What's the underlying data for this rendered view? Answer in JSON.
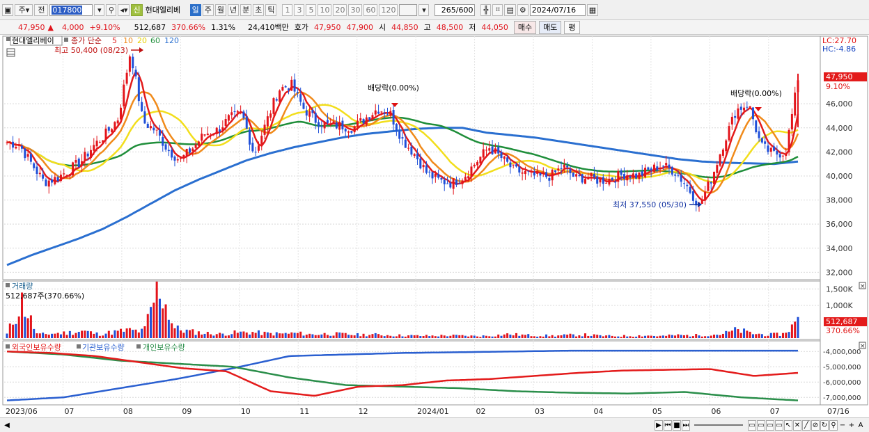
{
  "toolbar": {
    "market_label": "주",
    "prev_label": "전",
    "stock_code": "017800",
    "badge_label": "신",
    "stock_name": "현대엘리베",
    "period_buttons": [
      "일",
      "주",
      "월",
      "년",
      "분",
      "초",
      "틱"
    ],
    "selected_period": "일",
    "interval_buttons": [
      "1",
      "3",
      "5",
      "10",
      "20",
      "30",
      "60",
      "120"
    ],
    "bar_count": "265",
    "bar_total": "/600",
    "date": "2024/07/16"
  },
  "quote": {
    "price": "47,950",
    "change_arrow": "▲",
    "change": "4,000",
    "change_pct": "+9.10%",
    "volume": "512,687",
    "volume_ratio": "370.66%",
    "turnover": "1.31%",
    "amount": "24,410백만",
    "hoga_label": "호가",
    "hoga_sell": "47,950",
    "hoga_buy": "47,900",
    "open_label": "시",
    "open": "44,850",
    "high_label": "고",
    "high": "48,500",
    "low_label": "저",
    "low": "44,050",
    "buy_button": "매수",
    "sell_button": "매도",
    "eval_button": "평"
  },
  "price_panel": {
    "stock_name_box": "현대엘리베이",
    "ma_title": "종가 단순",
    "ma_periods": [
      {
        "label": "5",
        "color": "#e31b1b"
      },
      {
        "label": "10",
        "color": "#f08a1a"
      },
      {
        "label": "20",
        "color": "#e8d200"
      },
      {
        "label": "60",
        "color": "#1f8e3a"
      },
      {
        "label": "120",
        "color": "#2a6fd0"
      }
    ],
    "lc_label": "LC:27.70",
    "hc_label": "HC:-4.86",
    "price_tag": "47,950",
    "pct_tag": "9.10%",
    "high_annotation": "최고 50,400 (08/23)",
    "low_annotation": "최저 37,550 (05/30)",
    "dividend_annotation_1": "배당락(0.00%)",
    "dividend_annotation_2": "배당락(0.00%)"
  },
  "volume_panel": {
    "title": "거래량",
    "value_label": "512,687주(370.66%)",
    "tag_value": "512,687",
    "tag_pct": "370.66%"
  },
  "holding_panel": {
    "legend": [
      {
        "label": "외국인보유수량",
        "color": "#e31b1b"
      },
      {
        "label": "기관보유수량",
        "color": "#2a5fd0"
      },
      {
        "label": "개인보유수량",
        "color": "#2a8e4a"
      }
    ]
  },
  "chart_data": {
    "type": "line",
    "x_axis_labels": [
      "2023/06",
      "07",
      "08",
      "09",
      "10",
      "11",
      "12",
      "2024/01",
      "02",
      "03",
      "04",
      "05",
      "06",
      "07",
      "07/16"
    ],
    "price_axis_ticks": [
      "32,000",
      "34,000",
      "36,000",
      "38,000",
      "40,000",
      "42,000",
      "44,000",
      "46,000"
    ],
    "price_ylim": [
      31500,
      51500
    ],
    "volume_axis_ticks": [
      "1,500K",
      "1,000K",
      "500K"
    ],
    "volume_ylim": [
      0,
      1700
    ],
    "holding_axis_ticks": [
      "-4,000,000",
      "-5,000,000",
      "-6,000,000",
      "-7,000,000"
    ],
    "holding_ylim": [
      -7400000,
      -3400000
    ],
    "price_close_approx": [
      42800,
      42600,
      41000,
      39500,
      39800,
      40500,
      41200,
      42500,
      43500,
      44800,
      50400,
      44500,
      43800,
      42200,
      41300,
      42300,
      43500,
      43800,
      44800,
      45200,
      41800,
      44500,
      47200,
      47600,
      45600,
      44600,
      44200,
      44200,
      44000,
      44800,
      45600,
      45200,
      43000,
      41800,
      40200,
      39600,
      39400,
      40000,
      41200,
      42400,
      41500,
      40500,
      40200,
      39900,
      40000,
      40800,
      39800,
      39900,
      39600,
      39800,
      40200,
      40000,
      40500,
      40900,
      40400,
      39200,
      37550,
      39800,
      42800,
      45500,
      46000,
      42500,
      41800,
      42000,
      47950
    ],
    "ma120_approx": [
      32600,
      33400,
      34100,
      34800,
      35600,
      36600,
      37700,
      38800,
      39700,
      40500,
      41300,
      41900,
      42400,
      42800,
      43200,
      43500,
      43700,
      43900,
      44000,
      44000,
      43600,
      43400,
      43200,
      42900,
      42600,
      42300,
      42000,
      41700,
      41400,
      41200,
      41100,
      41050,
      41000,
      41200
    ],
    "volume_k_approx": [
      120,
      1120,
      100,
      140,
      160,
      220,
      120,
      180,
      240,
      200,
      1600,
      300,
      200,
      150,
      120,
      160,
      180,
      140,
      130,
      150,
      110,
      130,
      120,
      100,
      110,
      90,
      80,
      70,
      70,
      80,
      70,
      60,
      80,
      120,
      90,
      80,
      70,
      90,
      100,
      70,
      60,
      70,
      80,
      60,
      90,
      80,
      100,
      120,
      250,
      140,
      100,
      120,
      512
    ],
    "foreign_holding_approx": [
      -4000000,
      -4100000,
      -4300000,
      -4700000,
      -5100000,
      -5300000,
      -6600000,
      -6900000,
      -6300000,
      -6200000,
      -5900000,
      -5800000,
      -5600000,
      -5400000,
      -5250000,
      -5200000,
      -5150000,
      -5600000,
      -5400000
    ],
    "institution_holding_approx": [
      -7200000,
      -7000000,
      -6400000,
      -5800000,
      -5100000,
      -4300000,
      -4200000,
      -4100000,
      -4050000,
      -4000000,
      -3950000,
      -3950000,
      -3950000,
      -3950000,
      -3950000
    ],
    "individual_holding_approx": [
      -4000000,
      -4200000,
      -4600000,
      -4800000,
      -5000000,
      -5700000,
      -6200000,
      -6300000,
      -6400000,
      -6600000,
      -6700000,
      -6750000,
      -6650000,
      -7000000,
      -7200000
    ]
  },
  "statusbar": {
    "buttons": [
      "▶",
      "⏮",
      "■",
      "⏭"
    ],
    "zoom_minus": "−",
    "zoom_plus": "+",
    "font_label": "A"
  }
}
